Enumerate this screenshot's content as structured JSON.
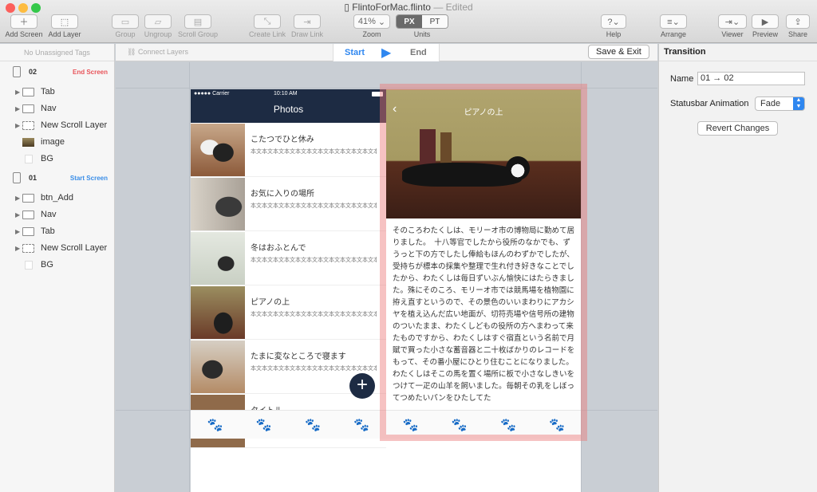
{
  "window": {
    "filename": "FlintoForMac.flinto",
    "status": "— Edited"
  },
  "toolbar": {
    "add_screen": "Add Screen",
    "add_layer": "Add Layer",
    "group": "Group",
    "ungroup": "Ungroup",
    "scroll_group": "Scroll Group",
    "create_link": "Create Link",
    "draw_link": "Draw Link",
    "zoom_value": "41%",
    "zoom_label": "Zoom",
    "unit_px": "PX",
    "unit_pt": "PT",
    "units_label": "Units",
    "help": "Help",
    "arrange": "Arrange",
    "viewer": "Viewer",
    "preview": "Preview",
    "share": "Share"
  },
  "layers": {
    "unassigned": "No Unassigned Tags",
    "screen_02": {
      "number": "02",
      "tag": "End Screen",
      "items": [
        {
          "name": "Tab"
        },
        {
          "name": "Nav"
        },
        {
          "name": "New Scroll Layer"
        },
        {
          "name": "image"
        },
        {
          "name": "BG"
        }
      ]
    },
    "screen_01": {
      "number": "01",
      "tag": "Start Screen",
      "items": [
        {
          "name": "btn_Add"
        },
        {
          "name": "Nav"
        },
        {
          "name": "Tab"
        },
        {
          "name": "New Scroll Layer"
        },
        {
          "name": "BG"
        }
      ]
    }
  },
  "canvasbar": {
    "connect_layers": "Connect Layers",
    "start": "Start",
    "end": "End",
    "save_exit": "Save & Exit"
  },
  "phone1": {
    "status_carrier": "●●●●● Carrier",
    "status_time": "10:10 AM",
    "nav_title": "Photos",
    "rows": [
      {
        "title": "こたつでひと休み",
        "text": "本文本文本文本文本文本文本文本文本文本文本文本文本文本文本文本文"
      },
      {
        "title": "お気に入りの場所",
        "text": "本文本文本文本文本文本文本文本文本文本文本文本文本文本文本文本文"
      },
      {
        "title": "冬はおふとんで",
        "text": "本文本文本文本文本文本文本文本文本文本文本文本文本文本文本文本文"
      },
      {
        "title": "ピアノの上",
        "text": "本文本文本文本文本文本文本文本文本文本文本文本文本文本文本文本文"
      },
      {
        "title": "たまに変なところで寝ます",
        "text": "本文本文本文本文本文本文本文本文本文本文本文本文本文本文本文本文"
      },
      {
        "title": "タイトル",
        "text": ""
      }
    ],
    "fab": "+"
  },
  "phone2": {
    "back": "‹",
    "nav_title": "ピアノの上",
    "body": "そのころわたくしは、モリーオ市の博物局に勤めて居りました。　十八等官でしたから役所のなかでも、ずうっと下の方でしたし俸給もほんのわずかでしたが、受持ちが標本の採集や整理で生れ付き好きなことでしたから、わたくしは毎日ずいぶん愉快にはたらきました。殊にそのころ、モリーオ市では競馬場を植物園に拵え直すというので、その景色のいいまわりにアカシヤを植え込んだ広い地面が、切符売場や信号所の建物のついたまま、わたくしどもの役所の方へまわって来たものですから、わたくしはすぐ宿直という名前で月賦で買った小さな蓄音器と二十枚ばかりのレコードをもって、その番小屋にひとり住むことになりました。わたくしはそこの馬を置く場所に板で小さなしきいをつけて一疋の山羊を飼いました。毎朝その乳をしぼってつめたいパンをひたしてた"
  },
  "transition": {
    "header": "Transition",
    "name_label": "Name",
    "name_value": "01 → 02",
    "statusbar_label": "Statusbar Animation",
    "statusbar_value": "Fade",
    "revert": "Revert Changes"
  },
  "colors": {
    "accent": "#2f87f0",
    "nav": "#1d2b43",
    "end_tag": "#e8545a",
    "start_tag": "#3a8ee8",
    "paw_active": "#f08ab8",
    "paw_inactive": "#9aa0a6",
    "selection": "#ec7878"
  }
}
